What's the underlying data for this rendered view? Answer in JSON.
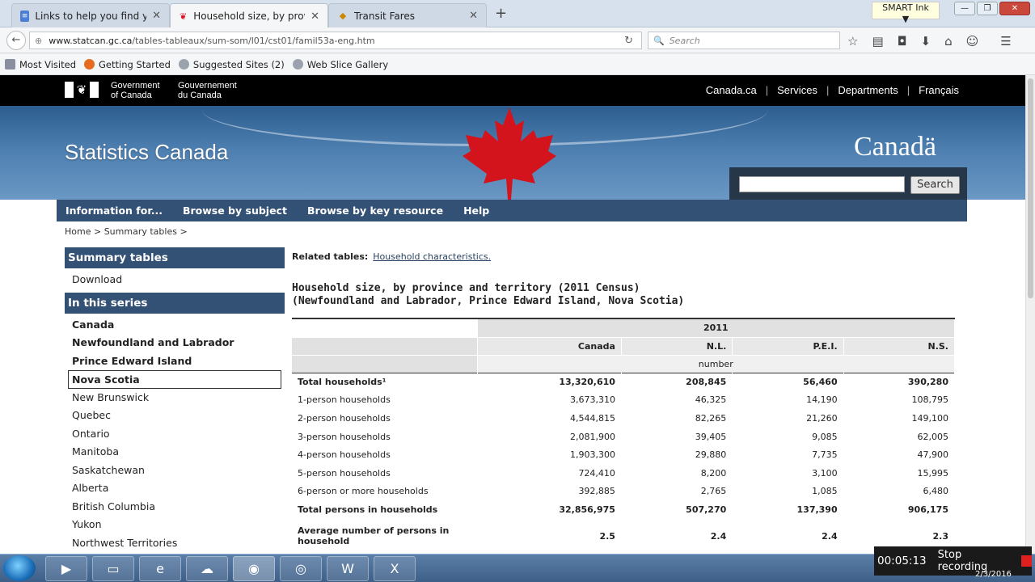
{
  "browser": {
    "tabs": [
      {
        "label": "Links to help you find your...",
        "icon": "doc-icon"
      },
      {
        "label": "Household size, by provinc...",
        "icon": "maple-leaf-icon"
      },
      {
        "label": "Transit Fares",
        "icon": "ticket-icon"
      }
    ],
    "new_tab": "+",
    "smart_ink": "SMART Ink",
    "url_host": "www.statcan.gc.ca",
    "url_path": "/tables-tableaux/sum-som/l01/cst01/famil53a-eng.htm",
    "search_placeholder": "Search",
    "bookmarks": [
      "Most Visited",
      "Getting Started",
      "Suggested Sites (2)",
      "Web Slice Gallery"
    ]
  },
  "goc": {
    "en_line1": "Government",
    "en_line2": "of Canada",
    "fr_line1": "Gouvernement",
    "fr_line2": "du Canada",
    "links": [
      "Canada.ca",
      "Services",
      "Departments",
      "Français"
    ]
  },
  "banner": {
    "site_title": "Statistics Canada",
    "wordmark": "Canadä",
    "search_button": "Search"
  },
  "menu": [
    "Information for...",
    "Browse by subject",
    "Browse by key resource",
    "Help"
  ],
  "breadcrumb": [
    "Home",
    "Summary tables"
  ],
  "sidebar": {
    "summary_header": "Summary tables",
    "download": "Download",
    "series_header": "In this series",
    "items": [
      {
        "label": "Canada",
        "bold": true
      },
      {
        "label": "Newfoundland and Labrador",
        "bold": true
      },
      {
        "label": "Prince Edward Island",
        "bold": true
      },
      {
        "label": "Nova Scotia",
        "bold": true,
        "selected": true
      },
      {
        "label": "New Brunswick"
      },
      {
        "label": "Quebec"
      },
      {
        "label": "Ontario"
      },
      {
        "label": "Manitoba"
      },
      {
        "label": "Saskatchewan"
      },
      {
        "label": "Alberta"
      },
      {
        "label": "British Columbia"
      },
      {
        "label": "Yukon"
      },
      {
        "label": "Northwest Territories"
      }
    ]
  },
  "content": {
    "related_label": "Related tables:",
    "related_link": "Household characteristics.",
    "title_line1": "Household size, by province and territory (2011 Census)",
    "title_line2": "(Newfoundland and Labrador, Prince Edward Island, Nova Scotia)"
  },
  "table": {
    "year": "2011",
    "columns": [
      "Canada",
      "N.L.",
      "P.E.I.",
      "N.S."
    ],
    "unit": "number",
    "rows": [
      {
        "label": "Total households¹",
        "values": [
          "13,320,610",
          "208,845",
          "56,460",
          "390,280"
        ],
        "bold": true
      },
      {
        "label": "1-person households",
        "values": [
          "3,673,310",
          "46,325",
          "14,190",
          "108,795"
        ]
      },
      {
        "label": "2-person households",
        "values": [
          "4,544,815",
          "82,265",
          "21,260",
          "149,100"
        ]
      },
      {
        "label": "3-person households",
        "values": [
          "2,081,900",
          "39,405",
          "9,085",
          "62,005"
        ]
      },
      {
        "label": "4-person households",
        "values": [
          "1,903,300",
          "29,880",
          "7,735",
          "47,900"
        ]
      },
      {
        "label": "5-person households",
        "values": [
          "724,410",
          "8,200",
          "3,100",
          "15,995"
        ]
      },
      {
        "label": "6-person or more households",
        "values": [
          "392,885",
          "2,765",
          "1,085",
          "6,480"
        ]
      },
      {
        "label": "Total persons in households",
        "values": [
          "32,856,975",
          "507,270",
          "137,390",
          "906,175"
        ],
        "bold": true
      },
      {
        "label": "Average number of persons in household",
        "values": [
          "2.5",
          "2.4",
          "2.4",
          "2.3"
        ],
        "bold": true,
        "tall": true
      }
    ]
  },
  "recorder": {
    "time": "00:05:13",
    "label": "Stop recording",
    "date": "2/3/2016"
  },
  "colors": {
    "menu_blue": "#335075",
    "banner_blue": "#4c7eb0",
    "maple_red": "#d3141c"
  }
}
